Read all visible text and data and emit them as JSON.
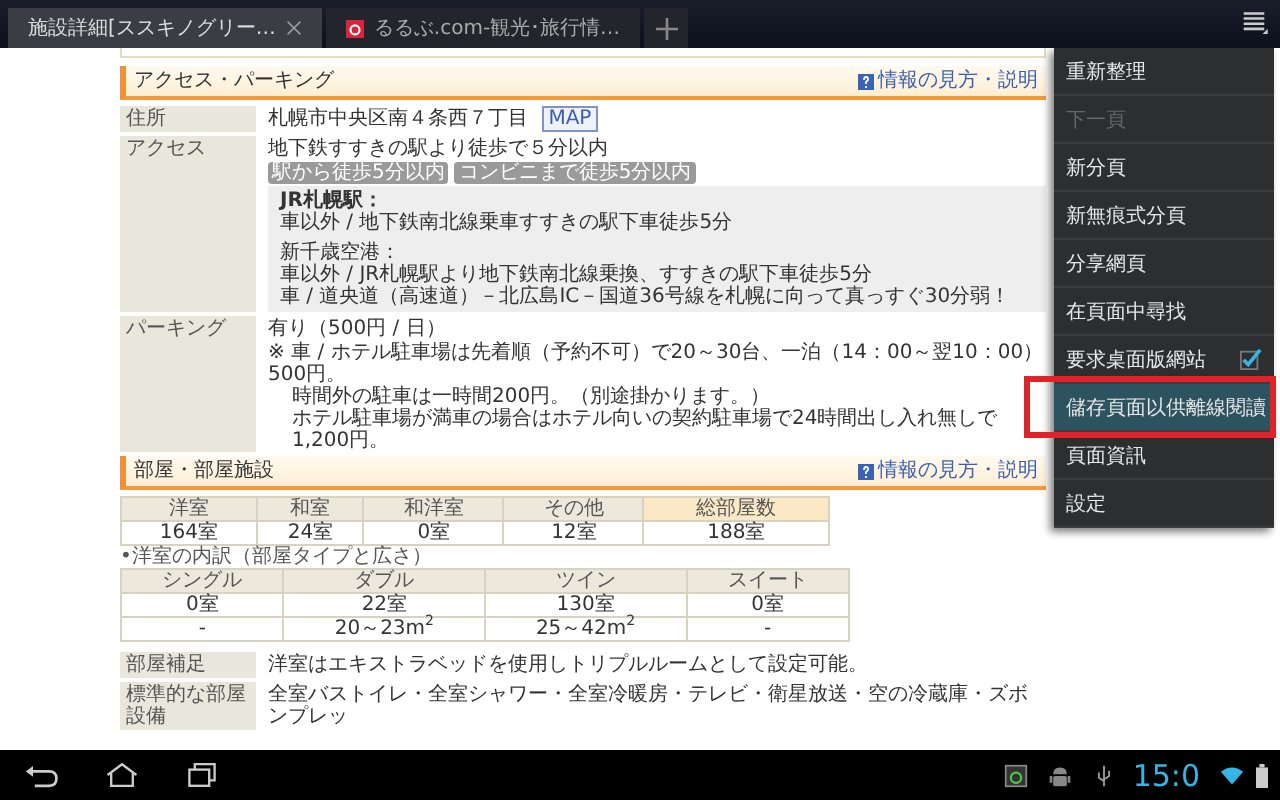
{
  "tabs": [
    {
      "label": "施設詳細[ススキノグリー…",
      "selected": true,
      "closable": true
    },
    {
      "label": "るるぶ.com-観光･旅行情…",
      "selected": false,
      "closable": false
    }
  ],
  "access_section": {
    "title": "アクセス・パーキング",
    "help_link": "情報の見方・説明",
    "address": {
      "label": "住所",
      "value": "札幌市中央区南４条西７丁目",
      "map_link": "MAP"
    },
    "access": {
      "label": "アクセス",
      "value": "地下鉄すすきの駅より徒歩で５分以内",
      "tags": [
        "駅から徒歩5分以内",
        "コンビニまで徒歩5分以内"
      ],
      "details": [
        {
          "heading": "JR札幌駅：",
          "lines": [
            "車以外 / 地下鉄南北線乗車すすきの駅下車徒歩5分"
          ]
        },
        {
          "heading": "新千歳空港：",
          "lines": [
            "車以外 / JR札幌駅より地下鉄南北線乗換、すすきの駅下車徒歩5分",
            "車 / 道央道（高速道）－北広島IC－国道36号線を札幌に向って真っすぐ30分弱！"
          ]
        }
      ]
    },
    "parking": {
      "label": "パーキング",
      "value": "有り（500円 / 日）",
      "notes": [
        "※ 車 / ホテル駐車場は先着順（予約不可）で20～30台、一泊（14：00～翌10：00）500円。",
        "時間外の駐車は一時間200円。（別途掛かります。）",
        "ホテル駐車場が満車の場合はホテル向いの契約駐車場で24時間出し入れ無しで1,200円。"
      ]
    }
  },
  "rooms_section": {
    "title": "部屋・部屋施設",
    "help_link": "情報の見方・説明",
    "room_counts": {
      "columns": [
        {
          "label": "洋室",
          "highlighted": false
        },
        {
          "label": "和室",
          "highlighted": false
        },
        {
          "label": "和洋室",
          "highlighted": false
        },
        {
          "label": "その他",
          "highlighted": false
        },
        {
          "label": "総部屋数",
          "highlighted": true
        }
      ],
      "rows": [
        [
          "164室",
          "24室",
          "0室",
          "12室",
          "188室"
        ]
      ]
    },
    "breakdown_caption": "•洋室の内訳（部屋タイプと広さ）",
    "breakdown": {
      "columns": [
        "シングル",
        "ダブル",
        "ツイン",
        "スイート"
      ],
      "rows": [
        [
          "0室",
          "22室",
          "130室",
          "0室"
        ],
        [
          "-",
          "20～23m$^{2}$",
          "25～42m$^{2}$",
          "-"
        ]
      ]
    },
    "facts": [
      {
        "label": "部屋補足",
        "value": "洋室はエキストラベッドを使用しトリプルルームとして設定可能。"
      },
      {
        "label": "標準的な部屋設備",
        "value": "全室バストイレ・全室シャワー・全室冷暖房・テレビ・衛星放送・空の冷蔵庫・ズボンプレッ"
      }
    ]
  },
  "menu": [
    {
      "label": "重新整理",
      "kind": "action",
      "disabled": false,
      "selected": false,
      "marked": false
    },
    {
      "label": "下一頁",
      "kind": "action",
      "disabled": true,
      "selected": false,
      "marked": false
    },
    {
      "label": "新分頁",
      "kind": "action",
      "disabled": false,
      "selected": false,
      "marked": false
    },
    {
      "label": "新無痕式分頁",
      "kind": "action",
      "disabled": false,
      "selected": false,
      "marked": false
    },
    {
      "label": "分享網頁",
      "kind": "action",
      "disabled": false,
      "selected": false,
      "marked": false
    },
    {
      "label": "在頁面中尋找",
      "kind": "action",
      "disabled": false,
      "selected": false,
      "marked": false
    },
    {
      "label": "要求桌面版網站",
      "kind": "checkbox",
      "checked": true,
      "disabled": false,
      "selected": false,
      "marked": false
    },
    {
      "label": "儲存頁面以供離線閱讀",
      "kind": "action",
      "disabled": false,
      "selected": true,
      "marked": true
    },
    {
      "label": "頁面資訊",
      "kind": "action",
      "disabled": false,
      "selected": false,
      "marked": false
    },
    {
      "label": "設定",
      "kind": "action",
      "disabled": false,
      "selected": false,
      "marked": false
    }
  ],
  "status_bar": {
    "clock": "15:0"
  }
}
